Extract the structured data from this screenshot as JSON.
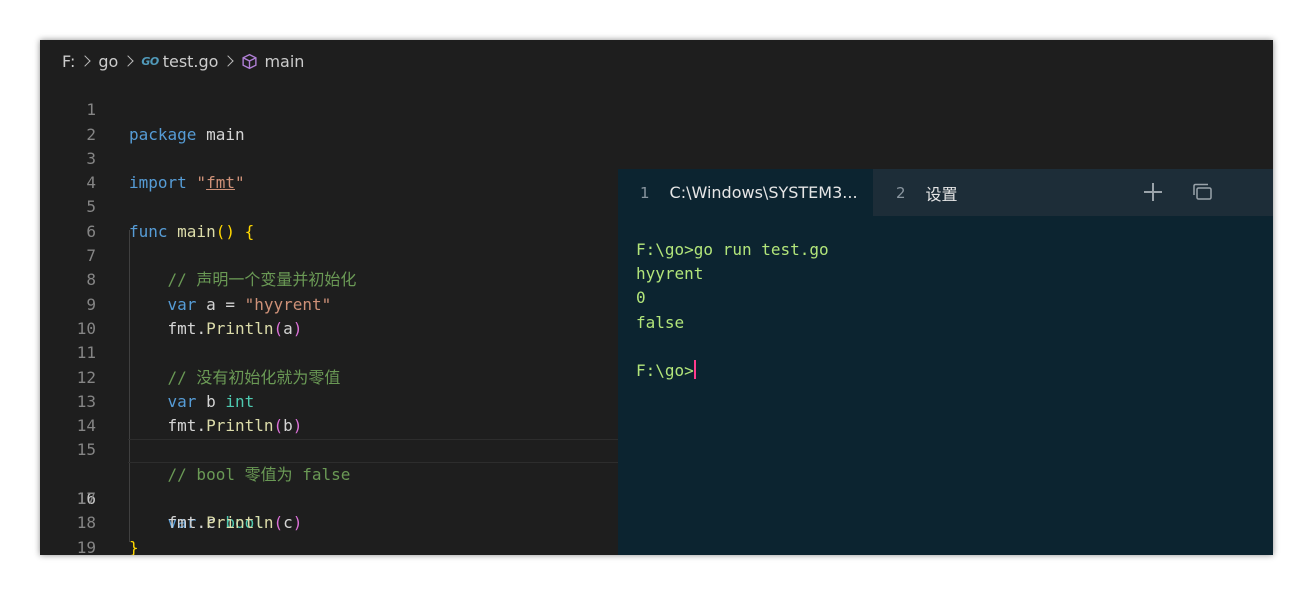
{
  "breadcrumb": {
    "drive": "F:",
    "folder": "go",
    "file": "test.go",
    "file_icon_text": "GO",
    "symbol": "main",
    "symbol_icon": "cube-icon"
  },
  "editor": {
    "current_line": 16,
    "lines": [
      {
        "n": "1"
      },
      {
        "n": "2"
      },
      {
        "n": "3"
      },
      {
        "n": "4"
      },
      {
        "n": "5"
      },
      {
        "n": "6"
      },
      {
        "n": "7"
      },
      {
        "n": "8"
      },
      {
        "n": "9"
      },
      {
        "n": "10"
      },
      {
        "n": "11"
      },
      {
        "n": "12"
      },
      {
        "n": "13"
      },
      {
        "n": "14"
      },
      {
        "n": "15"
      },
      {
        "n": "16"
      },
      {
        "n": "17"
      },
      {
        "n": "18"
      },
      {
        "n": "19"
      }
    ],
    "code": {
      "l1_kw": "package",
      "l1_name": " main",
      "l3_kw": "import",
      "l3_q1": " \"",
      "l3_pkg": "fmt",
      "l3_q2": "\"",
      "l5_kw": "func",
      "l5_fn": " main",
      "l5_paren": "()",
      "l5_brace": " {",
      "l7_cm": "    // 声明一个变量并初始化",
      "l8_indent": "    ",
      "l8_kw": "var",
      "l8_rest": " a = ",
      "l8_str": "\"hyyrent\"",
      "l9_indent": "    ",
      "l9_pkg": "fmt",
      "l9_dot": ".",
      "l9_fn": "Println",
      "l9_po": "(",
      "l9_arg": "a",
      "l9_pc": ")",
      "l11_cm": "    // 没有初始化就为零值",
      "l12_indent": "    ",
      "l12_kw": "var",
      "l12_rest": " b ",
      "l12_ty": "int",
      "l13_indent": "    ",
      "l13_pkg": "fmt",
      "l13_dot": ".",
      "l13_fn": "Println",
      "l13_po": "(",
      "l13_arg": "b",
      "l13_pc": ")",
      "l15_cm": "    // bool 零值为 false",
      "l16_indent": "    ",
      "l16_kw": "var",
      "l16_rest": " c ",
      "l16_ty": "bool",
      "l17_indent": "    ",
      "l17_pkg": "fmt",
      "l17_dot": ".",
      "l17_fn": "Println",
      "l17_po": "(",
      "l17_arg": "c",
      "l17_pc": ")",
      "l18_brace": "}"
    }
  },
  "terminal": {
    "tabs": [
      {
        "num": "1",
        "title": "C:\\Windows\\SYSTEM3...",
        "active": true
      },
      {
        "num": "2",
        "title": "设置",
        "active": false
      }
    ],
    "output": [
      "F:\\go>go run test.go",
      "hyyrent",
      "0",
      "false",
      "",
      "F:\\go>"
    ]
  },
  "colors": {
    "editor_bg": "#1e1e1e",
    "terminal_bg": "#0c2430",
    "terminal_tabbar": "#1d2d38",
    "terminal_text": "#b2e57a",
    "cursor": "#ff3b8d"
  }
}
